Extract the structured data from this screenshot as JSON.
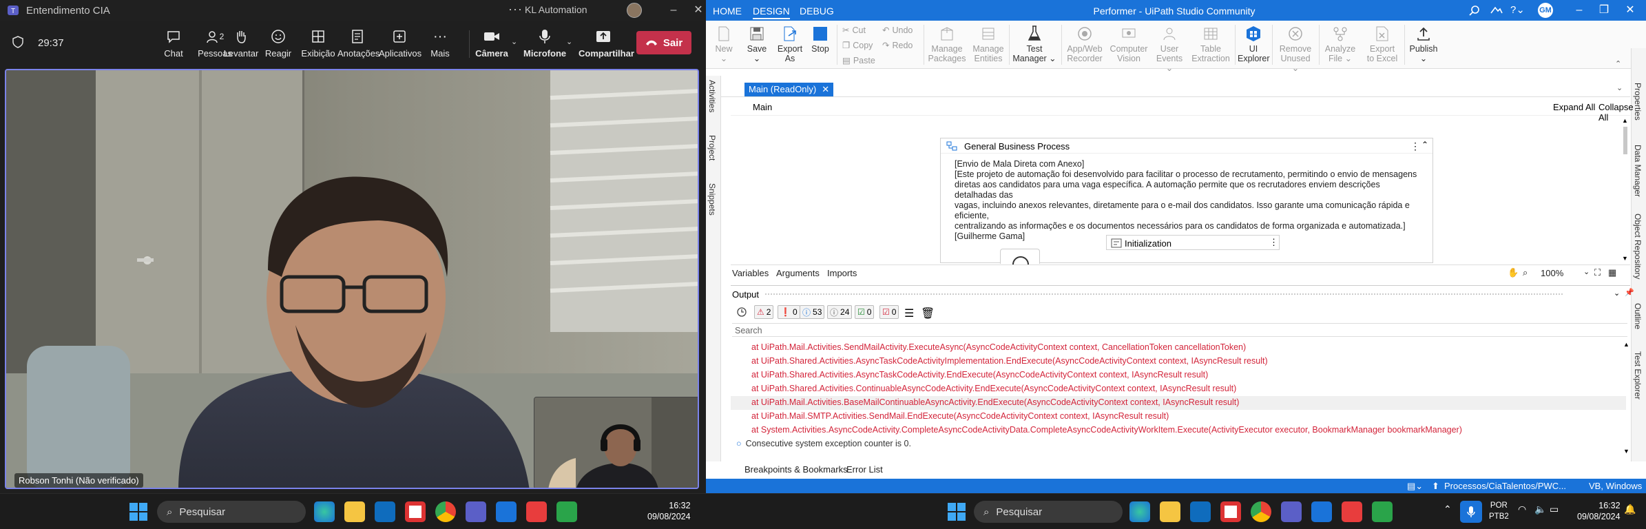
{
  "teams": {
    "title": "Entendimento CIA",
    "org": "KL Automation",
    "timer": "29:37",
    "toolbar": [
      {
        "label": "Chat",
        "icon": "chat-icon"
      },
      {
        "label": "Pessoas",
        "icon": "people-icon",
        "badge": "2"
      },
      {
        "label": "Levantar",
        "icon": "raise-hand-icon"
      },
      {
        "label": "Reagir",
        "icon": "react-icon"
      },
      {
        "label": "Exibição",
        "icon": "view-icon"
      },
      {
        "label": "Anotações",
        "icon": "notes-icon"
      },
      {
        "label": "Aplicativos",
        "icon": "apps-icon"
      },
      {
        "label": "Mais",
        "icon": "more-icon"
      },
      {
        "label": "Câmera",
        "icon": "camera-icon"
      },
      {
        "label": "Microfone",
        "icon": "mic-icon"
      },
      {
        "label": "Compartilhar",
        "icon": "share-icon"
      }
    ],
    "leave_label": "Sair",
    "participant_name": "Robson Tonhi (Não verificado)"
  },
  "studio": {
    "tabs": [
      "HOME",
      "DESIGN",
      "DEBUG"
    ],
    "active_tab": "DESIGN",
    "window_title": "Performer - UiPath Studio Community",
    "user_initials": "GM",
    "ribbon": {
      "new": "New",
      "save": "Save",
      "export": "Export",
      "export2": "As",
      "stop": "Stop",
      "cut": "Cut",
      "copy": "Copy",
      "paste": "Paste",
      "undo": "Undo",
      "redo": "Redo",
      "manage1": "Manage",
      "manage_pk": "Packages",
      "manage_en": "Entities",
      "test1": "Test",
      "test2": "Manager",
      "appweb1": "App/Web",
      "appweb2": "Recorder",
      "cv1": "Computer",
      "cv2": "Vision",
      "ue1": "User",
      "ue2": "Events",
      "te1": "Table",
      "te2": "Extraction",
      "ui1": "UI",
      "ui2": "Explorer",
      "ru1": "Remove",
      "ru2": "Unused",
      "af1": "Analyze",
      "af2": "File",
      "ex1": "Export",
      "ex2": "to Excel",
      "publish": "Publish"
    },
    "left_panels": [
      "Activities",
      "Project",
      "Snippets"
    ],
    "right_panels": [
      "Properties",
      "Data Manager",
      "Object Repository",
      "Outline",
      "Test Explorer"
    ],
    "doc_tab": "Main (ReadOnly)",
    "breadcrumb": "Main",
    "expand_all": "Expand All",
    "collapse_all": "Collapse All",
    "sequence_title": "General Business Process",
    "annotation": [
      "[Envio de Mala Direta com Anexo]",
      "[Este projeto de automação foi desenvolvido para facilitar o processo de recrutamento, permitindo o envio de mensagens",
      "diretas aos candidatos para uma vaga específica. A automação permite que os recrutadores enviem descrições detalhadas das",
      "vagas, incluindo anexos relevantes, diretamente para o e-mail dos candidatos. Isso garante uma comunicação rápida e eficiente,",
      "centralizando as informações e os documentos necessários para os candidatos de forma organizada e automatizada.]",
      "[Guilherme Gama]"
    ],
    "init_title": "Initialization",
    "bottom_designer_tabs": [
      "Variables",
      "Arguments",
      "Imports"
    ],
    "zoom": "100%",
    "output_title": "Output",
    "filters": [
      {
        "count": "2",
        "kind": "error"
      },
      {
        "count": "0",
        "kind": "warning"
      },
      {
        "count": "53",
        "kind": "info"
      },
      {
        "count": "24",
        "kind": "trace"
      },
      {
        "count": "0",
        "kind": "success"
      },
      {
        "count": "0",
        "kind": "failure"
      }
    ],
    "search_placeholder": "Search",
    "output_lines": [
      "at UiPath.Mail.Activities.SendMailActivity.ExecuteAsync(AsyncCodeActivityContext context, CancellationToken cancellationToken)",
      "at UiPath.Shared.Activities.AsyncTaskCodeActivityImplementation.EndExecute(AsyncCodeActivityContext context, IAsyncResult result)",
      "at UiPath.Shared.Activities.AsyncTaskCodeActivity.EndExecute(AsyncCodeActivityContext context, IAsyncResult result)",
      "at UiPath.Shared.Activities.ContinuableAsyncCodeActivity.EndExecute(AsyncCodeActivityContext context, IAsyncResult result)",
      "at UiPath.Mail.Activities.BaseMailContinuableAsyncActivity.EndExecute(AsyncCodeActivityContext context, IAsyncResult result)",
      "at UiPath.Mail.SMTP.Activities.SendMail.EndExecute(AsyncCodeActivityContext context, IAsyncResult result)",
      "at System.Activities.AsyncCodeActivity.CompleteAsyncCodeActivityData.CompleteAsyncCodeActivityWorkItem.Execute(ActivityExecutor executor, BookmarkManager bookmarkManager)"
    ],
    "info_line": "Consecutive system exception counter is 0.",
    "bottom_tabs": [
      "Breakpoints & Bookmarks",
      "Error List"
    ],
    "status_repo": "Processos/CiaTalentos/PWC...",
    "status_lang": "VB, Windows"
  },
  "taskbar": {
    "search_label": "Pesquisar",
    "time": "16:32",
    "date": "09/08/2024",
    "lang1": "POR",
    "lang2": "PTB2"
  },
  "colors": {
    "teams_accent": "#7b83eb",
    "leave": "#c4314b",
    "uipath_blue": "#1a73d9",
    "error_text": "#d3243a"
  }
}
